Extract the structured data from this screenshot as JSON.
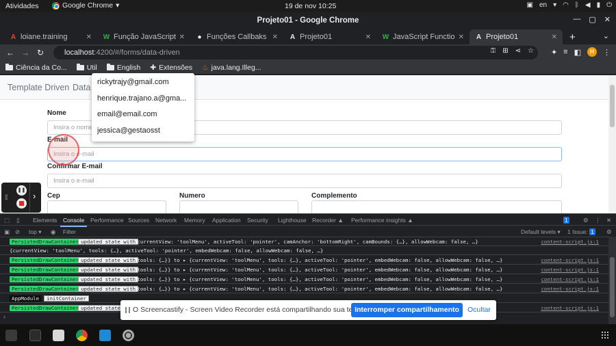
{
  "system": {
    "activities": "Atividades",
    "app_name": "Google Chrome",
    "datetime": "19 de nov  10:25",
    "lang": "en"
  },
  "window": {
    "title": "Projeto01 - Google Chrome"
  },
  "tabs": [
    {
      "label": "loiane.training",
      "icon": "A"
    },
    {
      "label": "Função JavaScript m",
      "icon": "W"
    },
    {
      "label": "Funções Callbaks (re",
      "icon": "●"
    },
    {
      "label": "Projeto01",
      "icon": "A"
    },
    {
      "label": "JavaScript Function",
      "icon": "W"
    },
    {
      "label": "Projeto01",
      "icon": "A"
    }
  ],
  "toolbar": {
    "url_host": "localhost",
    "url_rest": ":4200/#/forms/data-driven",
    "avatar": "H"
  },
  "bookmarks": [
    {
      "label": "Ciência da Co...",
      "icon": "folder"
    },
    {
      "label": "Util",
      "icon": "folder"
    },
    {
      "label": "English",
      "icon": "folder"
    },
    {
      "label": "Extensões",
      "icon": "puzzle-icon"
    },
    {
      "label": "java.lang.Illeg...",
      "icon": "java-icon"
    }
  ],
  "page": {
    "nav": [
      "Template Driven",
      "Data"
    ],
    "labels": {
      "nome": "Nome",
      "email": "E-mail",
      "confirmar": "Confirmar E-mail",
      "cep": "Cep",
      "numero": "Numero",
      "complemento": "Complemento"
    },
    "placeholders": {
      "nome": "Insira o nome",
      "email": "Insira o e-mail",
      "confirmar": "Insira o e-mail"
    },
    "autocomplete": [
      "rickytrajy@gmail.com",
      "henrique.trajano.a@gma...",
      "email@email.com",
      "jessica@gestaosst"
    ]
  },
  "devtools": {
    "tabs": [
      "Elements",
      "Console",
      "Performance",
      "Sources",
      "Network",
      "Memory",
      "Application",
      "Security",
      "Lighthouse",
      "Recorder ▲",
      "Performance insights ▲"
    ],
    "badge_count": "1",
    "top": "top",
    "filter_placeholder": "Filter",
    "levels": "Default levels ▾",
    "issues": "1 Issue: ",
    "issues_count": "1",
    "rows": [
      {
        "badge": "PersistedDrawContainer",
        "tag": "updated state with",
        "msg": "{currentView: 'toolMenu', activeTool: 'pointer', camAnchor: 'bottomRight', camBounds: {…}, allowWebcam: false, …}",
        "src": "content-script.js:1",
        "dark": false
      },
      {
        "badge": "",
        "tag": "",
        "msg": "{currentView: 'toolMenu', tools: {…}, activeTool: 'pointer', embedWebcam: false, allowWebcam: false, …}",
        "src": "",
        "dark": false
      },
      {
        "badge": "PersistedDrawContainer",
        "tag": "updated state with",
        "msg": "{tools: {…}} to ▸ {currentView: 'toolMenu', tools: {…}, activeTool: 'pointer', embedWebcam: false, allowWebcam: false, …}",
        "src": "content-script.js:1",
        "dark": false
      },
      {
        "badge": "PersistedDrawContainer",
        "tag": "updated state with",
        "msg": "{tools: {…}} to ▸ {currentView: 'toolMenu', tools: {…}, activeTool: 'pointer', embedWebcam: false, allowWebcam: false, …}",
        "src": "content-script.js:1",
        "dark": false
      },
      {
        "badge": "PersistedDrawContainer",
        "tag": "updated state with",
        "msg": "{tools: {…}} to ▸ {currentView: 'toolMenu', tools: {…}, activeTool: 'pointer', embedWebcam: false, allowWebcam: false, …}",
        "src": "content-script.js:1",
        "dark": false
      },
      {
        "badge": "PersistedDrawContainer",
        "tag": "updated state with",
        "msg": "{tools: {…}} to ▸ {currentView: 'toolMenu', tools: {…}, activeTool: 'pointer', embedWebcam: false, allowWebcam: false, …}",
        "src": "content-script.js:1",
        "dark": false
      },
      {
        "badge": "AppModule",
        "tag": "initContainer",
        "msg": "",
        "src": "",
        "dark": true
      },
      {
        "badge": "PersistedDrawContainer",
        "tag": "updated state with",
        "msg": "",
        "src": "content-script.js:1",
        "dark": false
      }
    ]
  },
  "share_banner": {
    "message": "O Screencastify - Screen Video Recorder está compartilhando sua tela.",
    "stop": "Interromper compartilhamento",
    "hide": "Ocultar"
  },
  "colors": {
    "accent": "#1a73e8",
    "console_badge": "#2fd26e",
    "chrome_dark": "#202124"
  }
}
